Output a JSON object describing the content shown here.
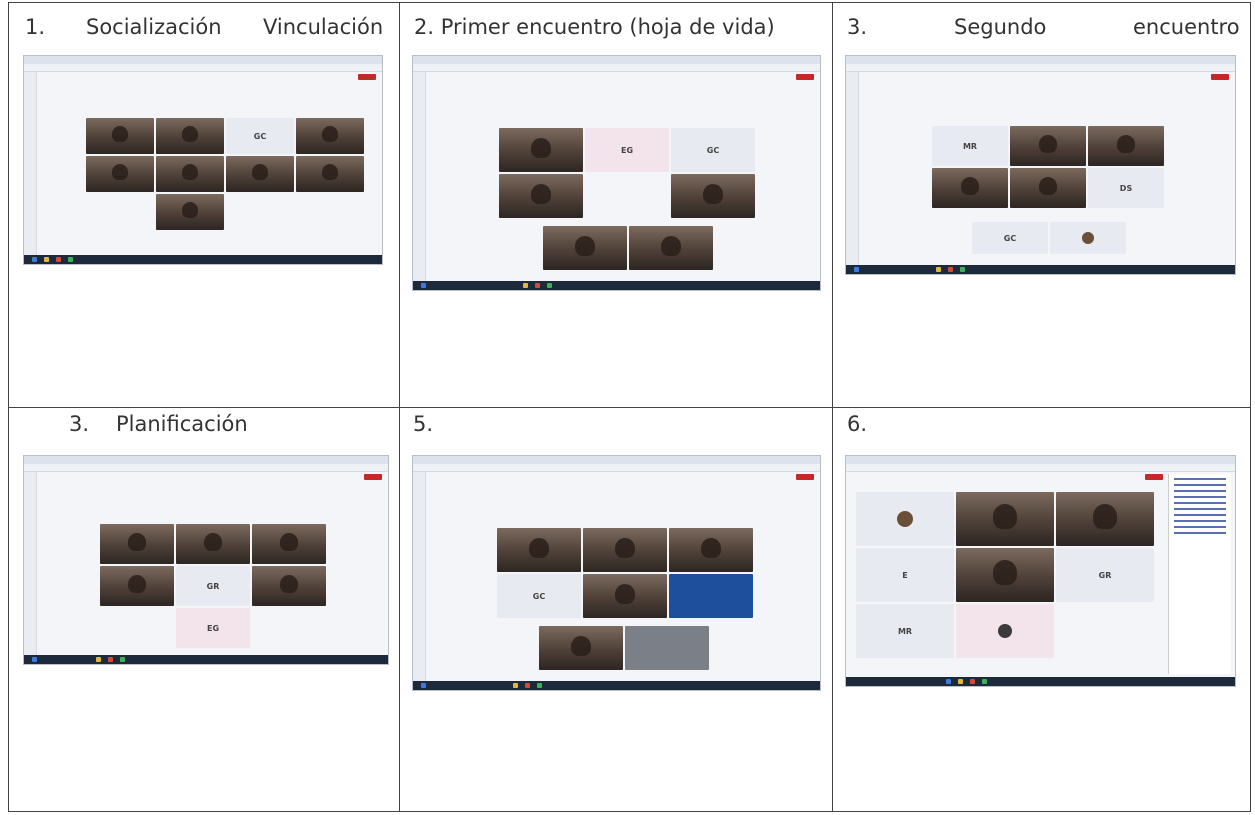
{
  "cells": [
    {
      "caption_1": "1.",
      "caption_2": "Socialización",
      "caption_3": "Vinculación"
    },
    {
      "caption_1": "2. Primer encuentro (hoja de vida)"
    },
    {
      "caption_1": "3.",
      "caption_2": "Segundo",
      "caption_3": "encuentro"
    },
    {
      "caption_1": "3.",
      "caption_2": "Planificación"
    },
    {
      "caption_1": "5."
    },
    {
      "caption_1": "6."
    }
  ],
  "tiles": {
    "gc": "GC",
    "eg": "EG",
    "mr": "MR",
    "ds": "DS",
    "gr": "GR",
    "e": "E"
  },
  "colors": {
    "border": "#444444",
    "taskbar": "#1d2a3c",
    "end_call": "#c62828"
  }
}
